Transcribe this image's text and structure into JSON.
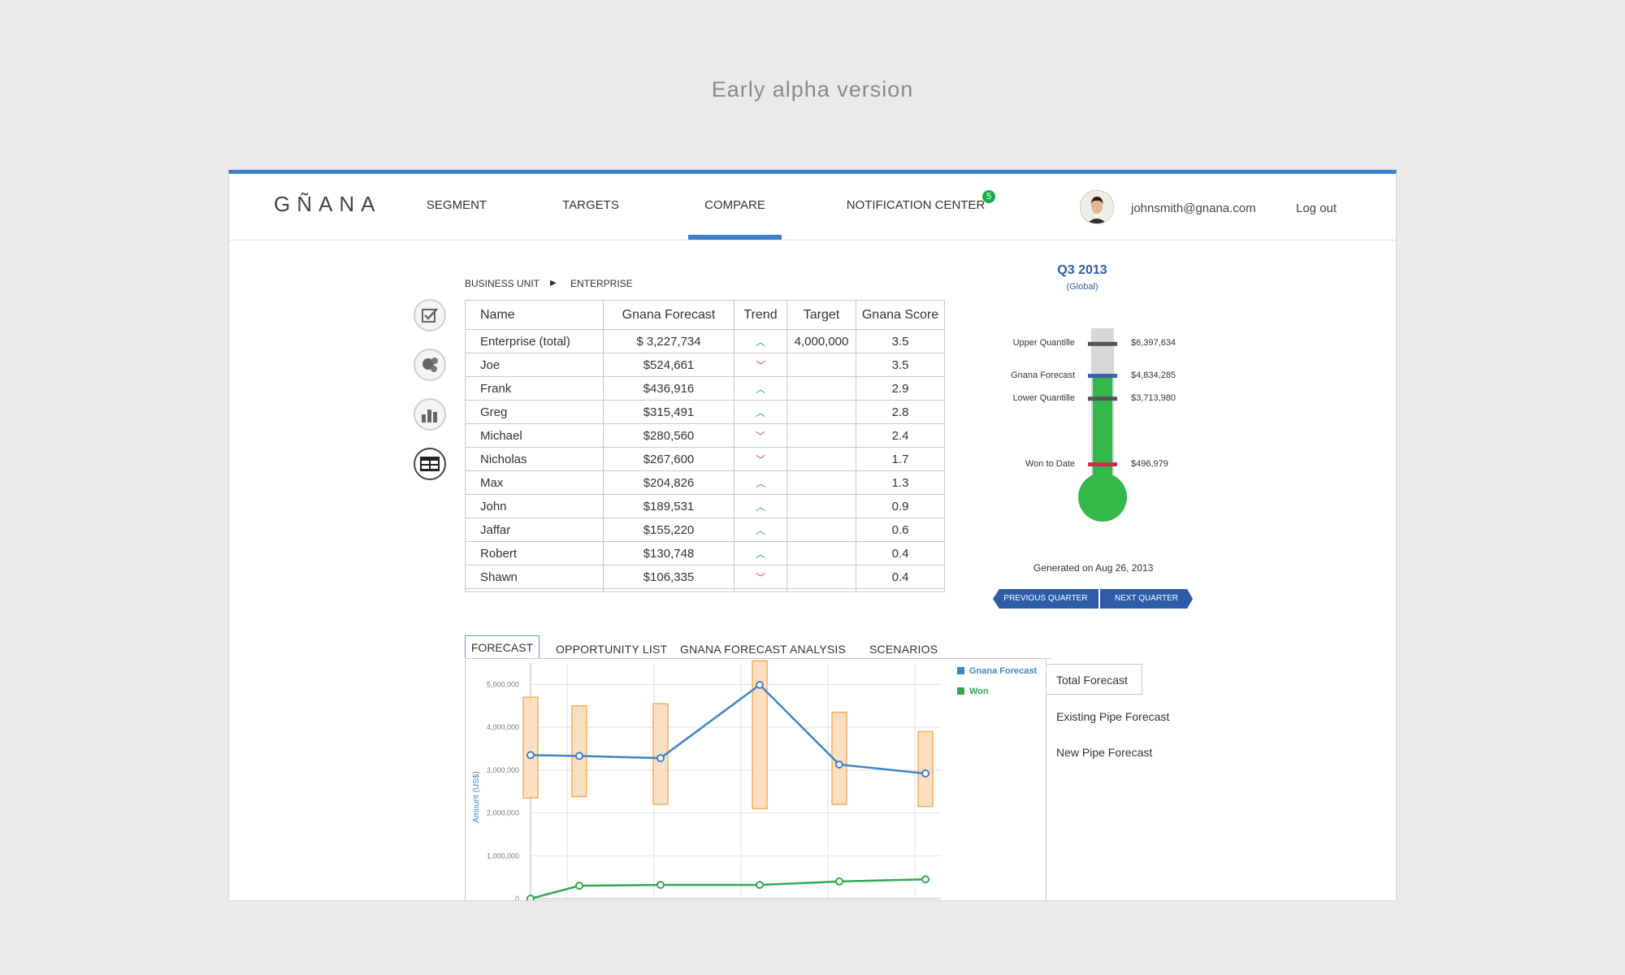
{
  "banner": "Early alpha version",
  "header": {
    "logo": "GÑANA",
    "nav": [
      "SEGMENT",
      "TARGETS",
      "COMPARE",
      "NOTIFICATION CENTER"
    ],
    "active_nav": "COMPARE",
    "notification_count": "5",
    "user_email": "johnsmith@gnana.com",
    "logout": "Log out"
  },
  "breadcrumb": {
    "level1": "BUSINESS UNIT",
    "separator": "▶",
    "level2": "ENTERPRISE"
  },
  "side_icons": [
    "checkbox-icon",
    "bubbles-icon",
    "bar-chart-icon",
    "table-icon"
  ],
  "table": {
    "columns": [
      "Name",
      "Gnana Forecast",
      "Trend",
      "Target",
      "Gnana Score"
    ],
    "rows": [
      {
        "name": "Enterprise (total)",
        "forecast": "$ 3,227,734",
        "trend": "up",
        "target": "4,000,000",
        "score": "3.5"
      },
      {
        "name": "Joe",
        "forecast": "$524,661",
        "trend": "down",
        "target": "",
        "score": "3.5"
      },
      {
        "name": "Frank",
        "forecast": "$436,916",
        "trend": "up",
        "target": "",
        "score": "2.9"
      },
      {
        "name": "Greg",
        "forecast": "$315,491",
        "trend": "up",
        "target": "",
        "score": "2.8"
      },
      {
        "name": "Michael",
        "forecast": "$280,560",
        "trend": "down",
        "target": "",
        "score": "2.4"
      },
      {
        "name": "Nicholas",
        "forecast": "$267,600",
        "trend": "down",
        "target": "",
        "score": "1.7"
      },
      {
        "name": "Max",
        "forecast": "$204,826",
        "trend": "up",
        "target": "",
        "score": "1.3"
      },
      {
        "name": "John",
        "forecast": "$189,531",
        "trend": "up",
        "target": "",
        "score": "0.9"
      },
      {
        "name": "Jaffar",
        "forecast": "$155,220",
        "trend": "up",
        "target": "",
        "score": "0.6"
      },
      {
        "name": "Robert",
        "forecast": "$130,748",
        "trend": "up",
        "target": "",
        "score": "0.4"
      },
      {
        "name": "Shawn",
        "forecast": "$106,335",
        "trend": "down",
        "target": "",
        "score": "0.4"
      }
    ]
  },
  "thermometer": {
    "title": "Q3 2013",
    "subtitle": "(Global)",
    "markers": [
      {
        "label": "Upper Quantille",
        "value": "$6,397,634",
        "amount": 6397634,
        "color": "#555555"
      },
      {
        "label": "Gnana Forecast",
        "value": "$4,834,285",
        "amount": 4834285,
        "color": "#3d5fb0"
      },
      {
        "label": "Lower Quantille",
        "value": "$3,713,980",
        "amount": 3713980,
        "color": "#555555"
      },
      {
        "label": "Won to Date",
        "value": "$496,979",
        "amount": 496979,
        "color": "#c8334a"
      }
    ],
    "fill_color": "#33b84a",
    "generated": "Generated on Aug 26, 2013",
    "prev_button": "PREVIOUS QUARTER",
    "next_button": "NEXT QUARTER"
  },
  "tabs": [
    "FORECAST",
    "OPPORTUNITY LIST",
    "GNANA FORECAST ANALYSIS",
    "SCENARIOS"
  ],
  "active_tab": "FORECAST",
  "side_panel": {
    "options": [
      "Total Forecast",
      "Existing Pipe Forecast",
      "New Pipe Forecast"
    ],
    "selected": "Total Forecast"
  },
  "chart_data": {
    "type": "line",
    "ylabel": "Amount (US$)",
    "ylim": [
      0,
      5500000
    ],
    "yticks": [
      0,
      1000000,
      2000000,
      3000000,
      4000000,
      5000000
    ],
    "ytick_labels": [
      "0",
      "1,000,000",
      "2,000,000",
      "3,000,000",
      "4,000,000",
      "5,000,000"
    ],
    "x": [
      1,
      2,
      3,
      4,
      5,
      6
    ],
    "series": [
      {
        "name": "Gnana Forecast",
        "color": "#3d85c6",
        "values": [
          3350000,
          3330000,
          3280000,
          4990000,
          3130000,
          2920000
        ]
      },
      {
        "name": "Won",
        "color": "#33a853",
        "values": [
          0,
          300000,
          320000,
          320000,
          400000,
          450000
        ]
      }
    ],
    "ranges": [
      {
        "low": 2350000,
        "high": 4700000
      },
      {
        "low": 2380000,
        "high": 4500000
      },
      {
        "low": 2200000,
        "high": 4550000
      },
      {
        "low": 2100000,
        "high": 5550000
      },
      {
        "low": 2200000,
        "high": 4350000
      },
      {
        "low": 2150000,
        "high": 3900000
      }
    ],
    "range_color": "#f5a54a",
    "legend": "top-right",
    "grid": true
  }
}
